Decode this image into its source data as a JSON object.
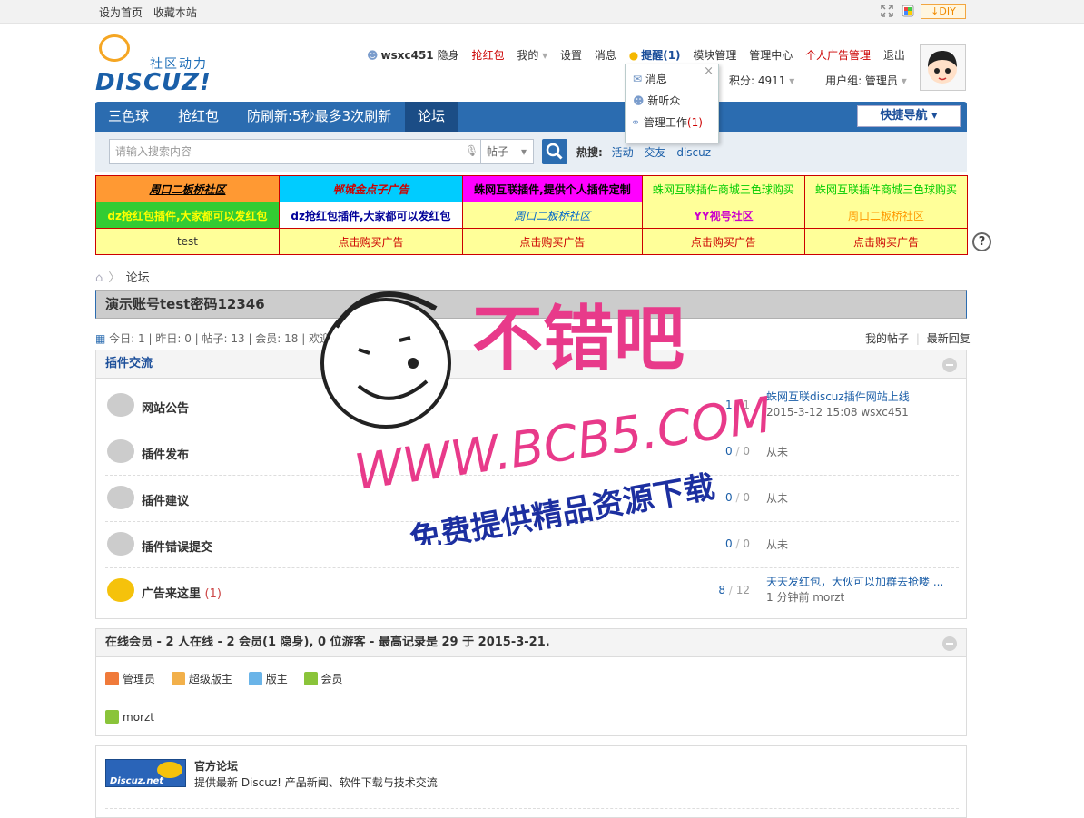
{
  "topbar": {
    "set_home": "设为首页",
    "bookmark": "收藏本站",
    "diy": "↓DIY"
  },
  "logo": {
    "slogan": "社区动力",
    "word": "DISCUZ!"
  },
  "user_menu": {
    "username": "wsxc451",
    "invisible": "隐身",
    "red_packet": "抢红包",
    "mine": "我的",
    "settings": "设置",
    "messages": "消息",
    "reminder": "提醒(1)",
    "module_admin": "模块管理",
    "admin_center": "管理中心",
    "personal_ads": "个人广告管理",
    "logout": "退出",
    "points": "积分: 4911",
    "usergroup": "用户组: 管理员"
  },
  "popup": {
    "close": "×",
    "items": [
      {
        "label": "消息"
      },
      {
        "label": "新听众"
      },
      {
        "label": "管理工作",
        "count": "(1)"
      }
    ]
  },
  "nav": {
    "items": [
      "三色球",
      "抢红包",
      "防刷新:5秒最多3次刷新",
      "论坛"
    ],
    "quick": "快捷导航 ▾"
  },
  "search": {
    "placeholder": "请输入搜索内容",
    "type": "帖子",
    "hot_label": "热搜:",
    "hot": [
      "活动",
      "交友",
      "discuz"
    ]
  },
  "ads": {
    "rows": [
      [
        {
          "t": "周口二板桥社区",
          "c": "#000",
          "bg": "#ff9933"
        },
        {
          "t": "郸城金点子广告",
          "c": "#c00",
          "bg": "#00ccff"
        },
        {
          "t": "蛛网互联插件,提供个人插件定制",
          "c": "#fff",
          "bg": "#ff00ff"
        },
        {
          "t": "蛛网互联插件商城三色球购买",
          "c": "#0c0",
          "bg": "#ffff99"
        },
        {
          "t": "蛛网互联插件商城三色球购买",
          "c": "#0c0",
          "bg": "#ffff99"
        }
      ],
      [
        {
          "t": "dz抢红包插件,大家都可以发红包",
          "c": "#ff0",
          "bg": "#3c3"
        },
        {
          "t": "dz抢红包插件,大家都可以发红包",
          "c": "#009",
          "bg": "#fff"
        },
        {
          "t": "周口二板桥社区",
          "c": "#06c",
          "bg": "#ffff99"
        },
        {
          "t": "YY视号社区",
          "c": "#c0c",
          "bg": "#ffff99"
        },
        {
          "t": "周口二板桥社区",
          "c": "#f90",
          "bg": "#ffff99"
        }
      ],
      [
        {
          "t": "test",
          "c": "#333",
          "bg": "#ffff99"
        },
        {
          "t": "点击购买广告",
          "c": "#c00",
          "bg": "#ffff99"
        },
        {
          "t": "点击购买广告",
          "c": "#c00",
          "bg": "#ffff99"
        },
        {
          "t": "点击购买广告",
          "c": "#c00",
          "bg": "#ffff99"
        },
        {
          "t": "点击购买广告",
          "c": "#c00",
          "bg": "#ffff99"
        }
      ]
    ]
  },
  "help": "?",
  "breadcrumb": {
    "sep": "〉",
    "current": "论坛"
  },
  "notice": "演示账号test密码12346",
  "stats": {
    "text": "今日: 1 | 昨日: 0 | 帖子: 13 | 会员: 18 | 欢迎新会员: morzt",
    "my_posts": "我的帖子",
    "latest": "最新回复"
  },
  "category": {
    "title": "插件交流"
  },
  "forums": [
    {
      "name": "网站公告",
      "extra": "",
      "threads": "1",
      "posts": "1",
      "last_title": "蛛网互联discuz插件网站上线",
      "last_meta": "2015-3-12 15:08 wsxc451",
      "new": false
    },
    {
      "name": "插件发布",
      "extra": "",
      "threads": "0",
      "posts": "0",
      "last_title": "",
      "last_meta": "从未",
      "new": false
    },
    {
      "name": "插件建议",
      "extra": "",
      "threads": "0",
      "posts": "0",
      "last_title": "",
      "last_meta": "从未",
      "new": false
    },
    {
      "name": "插件错误提交",
      "extra": "",
      "threads": "0",
      "posts": "0",
      "last_title": "",
      "last_meta": "从未",
      "new": false
    },
    {
      "name": "广告来这里",
      "extra": "(1)",
      "threads": "8",
      "posts": "12",
      "last_title": "天天发红包，大伙可以加群去抢喽 ...",
      "last_meta": "1 分钟前 morzt",
      "new": true
    }
  ],
  "online": {
    "title": "在线会员 - 2 人在线 - 2 会员(1 隐身), 0 位游客 - 最高记录是 29 于 2015-3-21.",
    "groups": [
      "管理员",
      "超级版主",
      "版主",
      "会员"
    ],
    "users": [
      "morzt"
    ]
  },
  "links": {
    "title": "官方论坛",
    "desc": "提供最新 Discuz! 产品新闻、软件下载与技术交流",
    "logo_text": "Discuz.net"
  },
  "watermark": {
    "line1": "不错吧",
    "line2": "WWW.BCB5.COM",
    "line3": "免费提供精品资源下载"
  },
  "colors": {
    "nav": "#2b6cb0",
    "nav_active": "#1b4d86",
    "link": "#1c5fa8",
    "red": "#cc0000"
  }
}
